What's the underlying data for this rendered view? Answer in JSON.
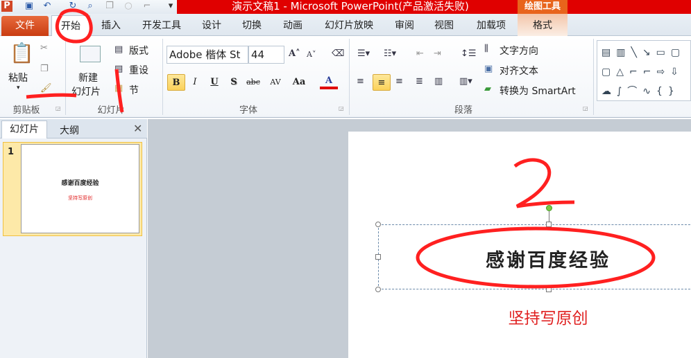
{
  "window": {
    "title": "演示文稿1 - Microsoft PowerPoint(产品激活失败)",
    "context_tab_group": "绘图工具"
  },
  "tabs": [
    "文件",
    "开始",
    "插入",
    "开发工具",
    "设计",
    "切换",
    "动画",
    "幻灯片放映",
    "审阅",
    "视图",
    "加载项",
    "格式"
  ],
  "clipboard": {
    "paste": "粘贴",
    "label": "剪贴板"
  },
  "slides_group": {
    "new_slide_1": "新建",
    "new_slide_2": "幻灯片",
    "layout": "版式",
    "reset": "重设",
    "section": "节",
    "label": "幻灯片"
  },
  "font": {
    "name": "Adobe 楷体 St",
    "size": "44",
    "label": "字体",
    "bold": "B",
    "italic": "I",
    "underline": "U",
    "shadow": "S",
    "strike": "abc",
    "spacing": "AV",
    "case": "Aa",
    "color": "A"
  },
  "paragraph": {
    "text_direction": "文字方向",
    "align_text": "对齐文本",
    "smartart": "转换为 SmartArt",
    "label": "段落"
  },
  "pane": {
    "tab_slides": "幻灯片",
    "tab_outline": "大纲",
    "slide_number": "1"
  },
  "slide": {
    "title": "感谢百度经验",
    "subtitle": "坚持写原创"
  },
  "colors": {
    "accent_red": "#e00000",
    "subtitle": "#e02020",
    "annotation": "#ff2020"
  }
}
